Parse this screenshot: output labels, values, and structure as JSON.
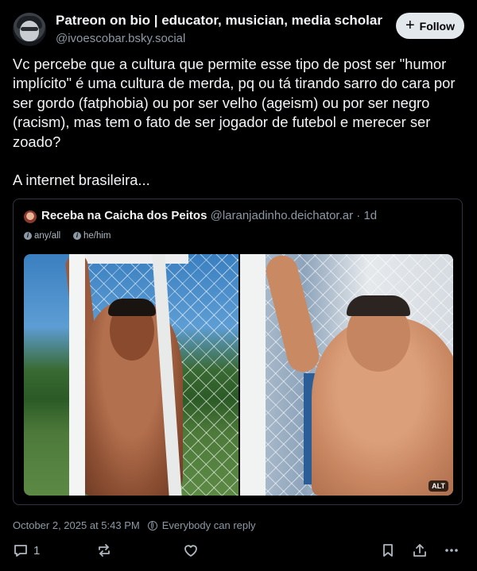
{
  "author": {
    "display_name": "Patreon on bio | educator, musician, media scholar",
    "handle": "@ivoescobar.bsky.social",
    "follow_label": "Follow"
  },
  "post": {
    "text": "Vc percebe que a cultura que permite esse tipo de post ser \"humor implícito\" é uma cultura de merda, pq ou tá tirando sarro do cara por ser gordo (fatphobia) ou por ser velho (ageism) ou por ser negro (racism), mas tem o fato de ser jogador de futebol e merecer ser zoado?\n\nA internet brasileira...",
    "timestamp": "October 2, 2025 at 5:43 PM",
    "reply_setting": "Everybody can reply",
    "reply_count": "1"
  },
  "quote": {
    "display_name": "Receba na Caicha dos Peitos",
    "handle": "@laranjadinho.deichator.ar",
    "age": "· 1d",
    "pronouns": [
      "any/all",
      "he/him"
    ],
    "alt_badge": "ALT"
  },
  "icons": {
    "reply": "reply-icon",
    "repost": "repost-icon",
    "like": "heart-icon",
    "bookmark": "bookmark-icon",
    "share": "share-icon",
    "more": "more-icon"
  }
}
